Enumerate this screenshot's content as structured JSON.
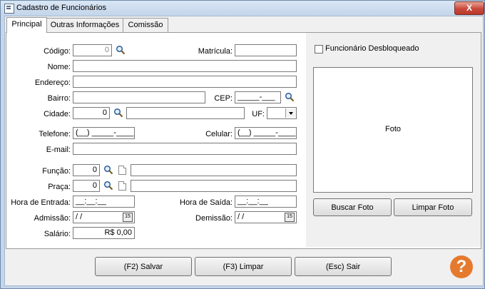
{
  "window": {
    "title": "Cadastro de Funcionários",
    "close_label": "X"
  },
  "tabs": [
    {
      "label": "Principal",
      "active": true
    },
    {
      "label": "Outras Informações",
      "active": false
    },
    {
      "label": "Comissão",
      "active": false
    }
  ],
  "form": {
    "codigo": {
      "label": "Código:",
      "value": "0"
    },
    "matricula": {
      "label": "Matrícula:",
      "value": ""
    },
    "nome": {
      "label": "Nome:",
      "value": ""
    },
    "endereco": {
      "label": "Endereço:",
      "value": ""
    },
    "bairro": {
      "label": "Bairro:",
      "value": ""
    },
    "cep": {
      "label": "CEP:",
      "value": "_____-___"
    },
    "cidade": {
      "label": "Cidade:",
      "value": "0",
      "name_value": ""
    },
    "uf": {
      "label": "UF:",
      "value": ""
    },
    "telefone": {
      "label": "Telefone:",
      "value": "(__) _____-____"
    },
    "celular": {
      "label": "Celular:",
      "value": "(__) _____-____"
    },
    "email": {
      "label": "E-mail:",
      "value": ""
    },
    "funcao": {
      "label": "Função:",
      "value": "0",
      "desc": ""
    },
    "praca": {
      "label": "Praça:",
      "value": "0",
      "desc": ""
    },
    "hora_entrada": {
      "label": "Hora de Entrada:",
      "value": "__:__:__"
    },
    "hora_saida": {
      "label": "Hora de Saída:",
      "value": "__:__:__"
    },
    "admissao": {
      "label": "Admissão:",
      "value": " /  /"
    },
    "demissao": {
      "label": "Demissão:",
      "value": " /  /"
    },
    "salario": {
      "label": "Salário:",
      "value": "R$ 0,00"
    },
    "calendar_glyph": "15"
  },
  "side": {
    "desbloqueado_label": "Funcionário Desbloqueado",
    "desbloqueado_checked": false,
    "photo_label": "Foto",
    "buscar_foto": "Buscar Foto",
    "limpar_foto": "Limpar Foto"
  },
  "buttons": {
    "salvar": "(F2) Salvar",
    "limpar": "(F3) Limpar",
    "sair": "(Esc) Sair"
  },
  "help_glyph": "?",
  "colors": {
    "help": "#e57a2e",
    "close": "#c9483a",
    "title_bar": "#c5d6ea"
  }
}
